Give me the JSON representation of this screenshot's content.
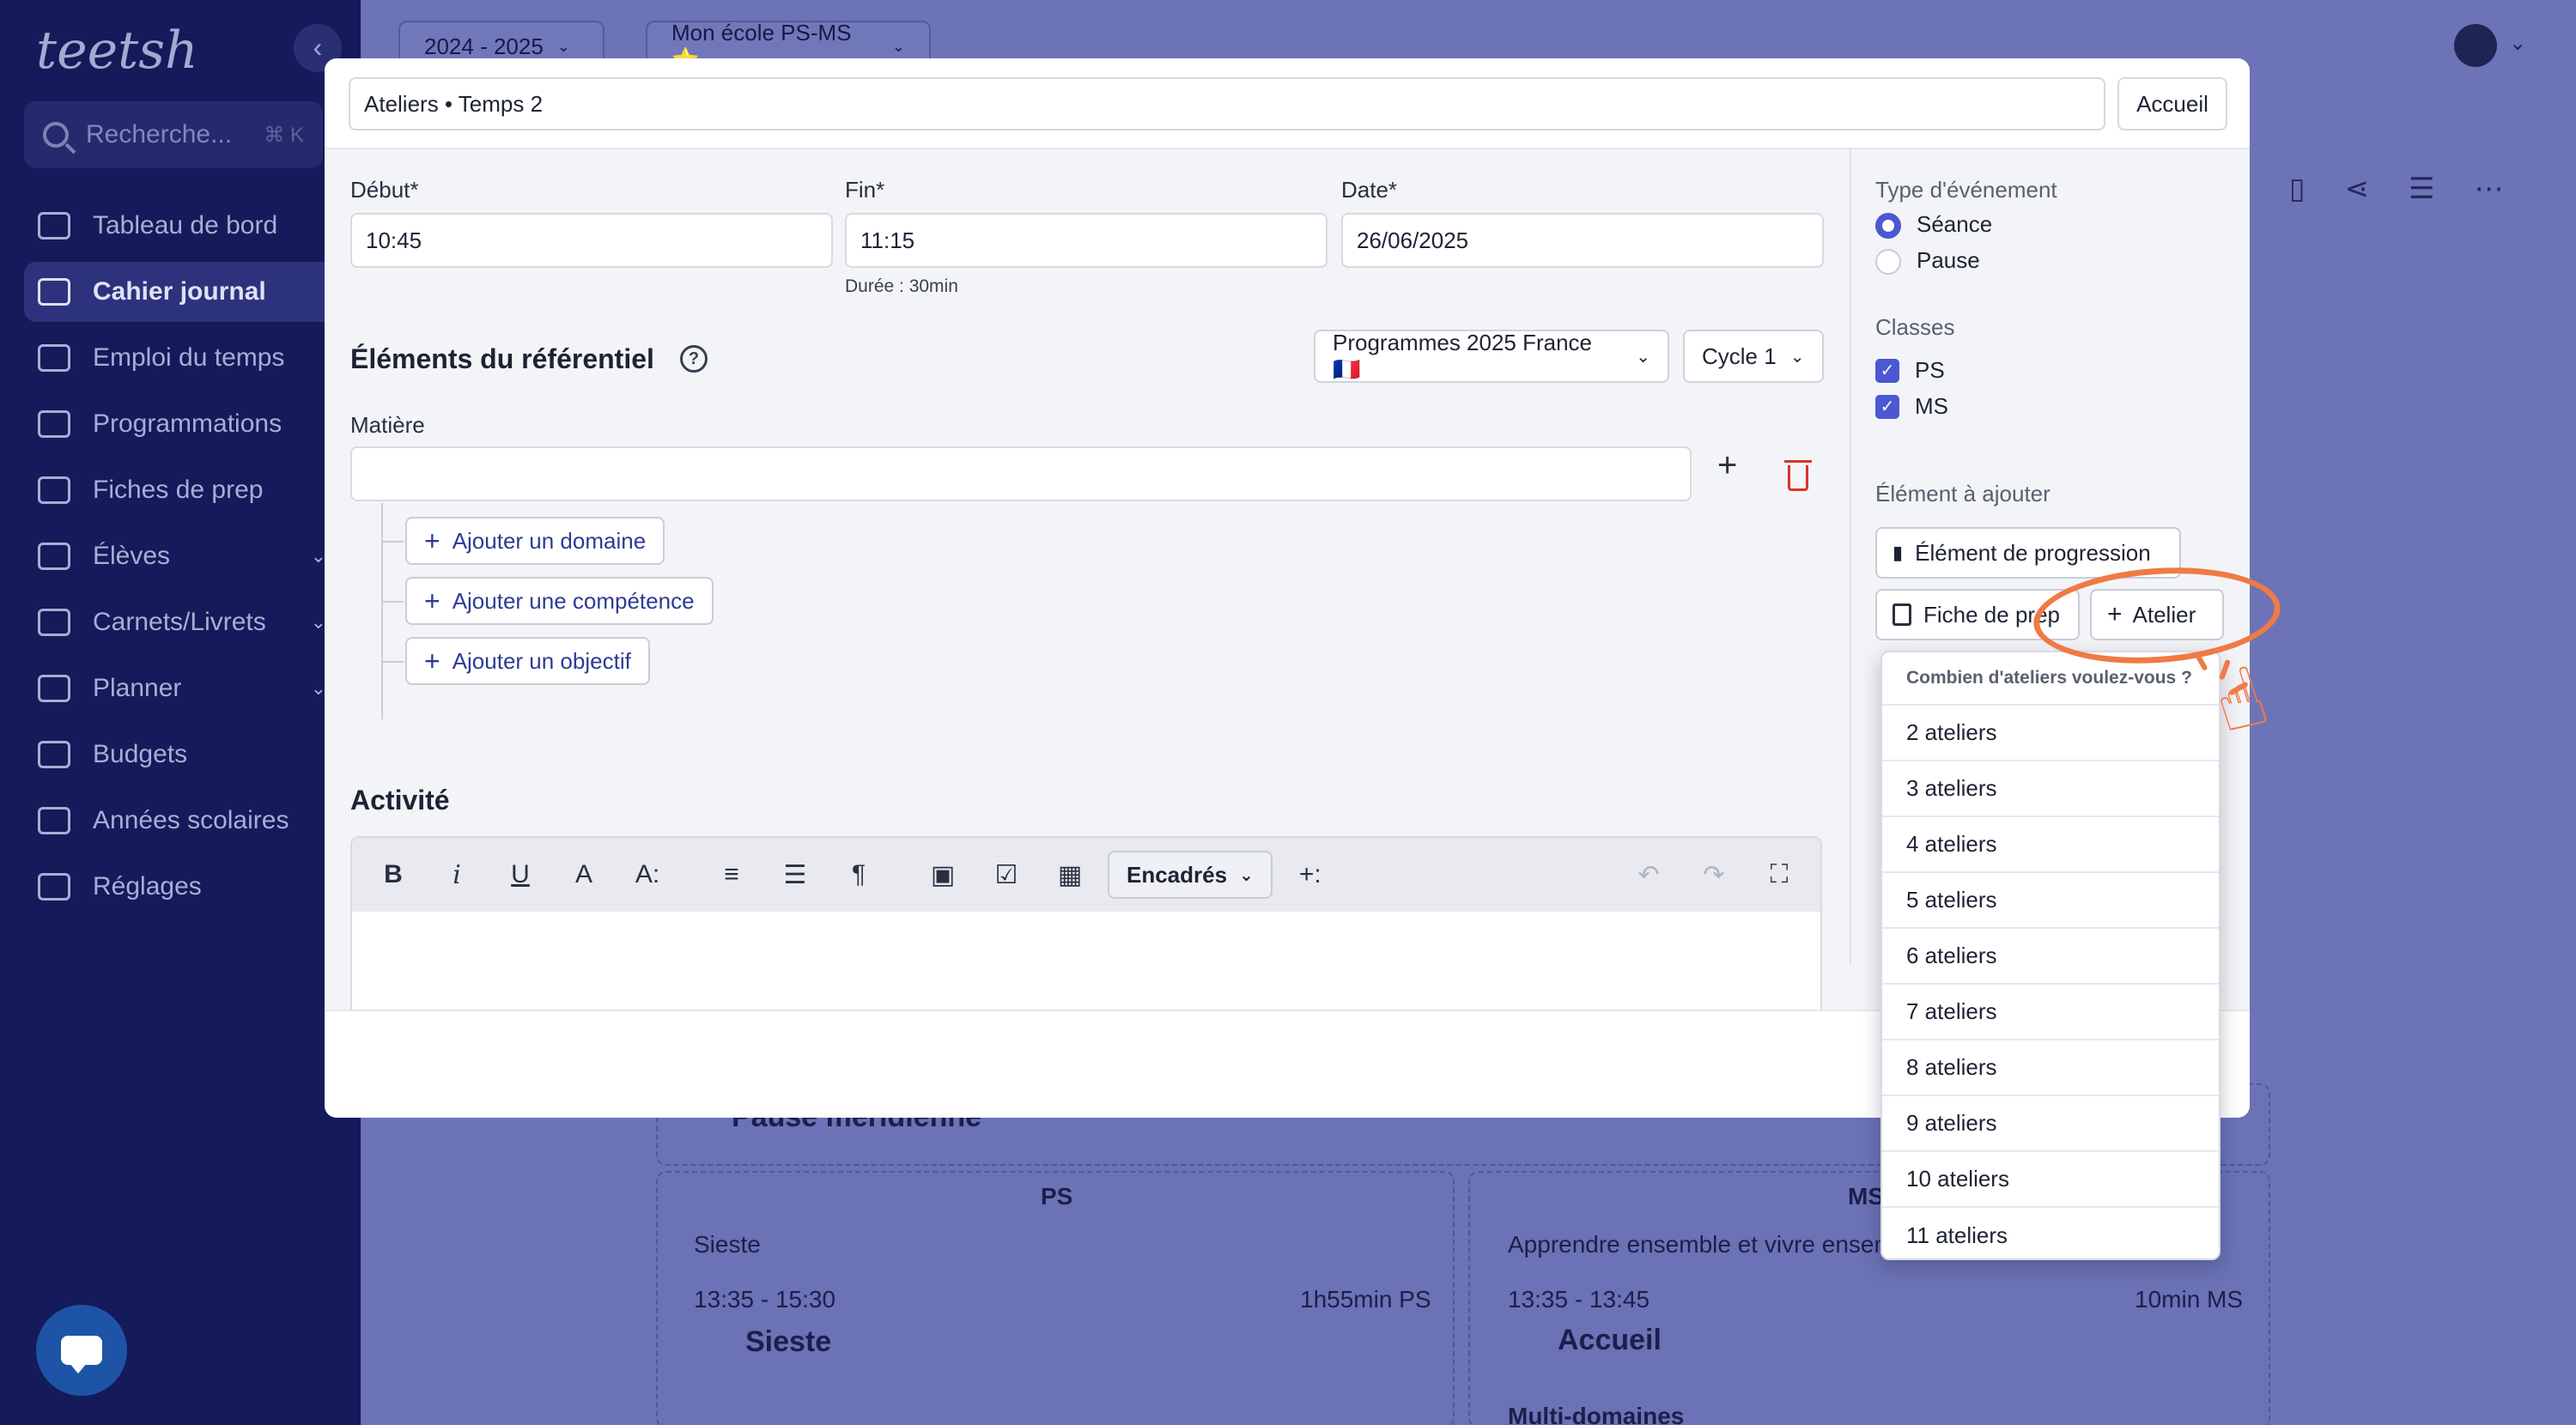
{
  "app": {
    "logo": "teetsh"
  },
  "sidebar": {
    "search_placeholder": "Recherche...",
    "search_shortcut": "⌘ K",
    "items": [
      {
        "label": "Tableau de bord",
        "icon": "dashboard-icon"
      },
      {
        "label": "Cahier journal",
        "icon": "book-icon",
        "active": true
      },
      {
        "label": "Emploi du temps",
        "icon": "calendar-icon"
      },
      {
        "label": "Programmations",
        "icon": "program-icon"
      },
      {
        "label": "Fiches de prep",
        "icon": "file-icon"
      },
      {
        "label": "Élèves",
        "icon": "students-icon",
        "expandable": true
      },
      {
        "label": "Carnets/Livrets",
        "icon": "notebook-icon",
        "expandable": true
      },
      {
        "label": "Planner",
        "icon": "planner-icon",
        "expandable": true
      },
      {
        "label": "Budgets",
        "icon": "piggy-bank-icon"
      },
      {
        "label": "Années scolaires",
        "icon": "school-icon"
      },
      {
        "label": "Réglages",
        "icon": "settings-icon"
      }
    ]
  },
  "topbar": {
    "year": "2024 - 2025",
    "school": "Mon école PS-MS ⭐"
  },
  "background": {
    "pause_label": "Pause méridienne",
    "col_ps": "PS",
    "col_ms": "MS",
    "ps_card_title": "Sieste",
    "ps_card_time": "13:35 - 15:30",
    "ps_card_duration": "1h55min PS",
    "ps_card_name": "Sieste",
    "ms_card_title": "Apprendre ensemble et vivre ensemble",
    "ms_card_time": "13:35 - 13:45",
    "ms_card_duration": "10min MS",
    "ms_card_name": "Accueil",
    "ms_card2_title": "Multi-domaines"
  },
  "modal": {
    "title_value": "Ateliers • Temps 2",
    "accueil_button": "Accueil",
    "start_label": "Début*",
    "start_value": "10:45",
    "end_label": "Fin*",
    "end_value": "11:15",
    "duration_text": "Durée : 30min",
    "date_label": "Date*",
    "date_value": "26/06/2025",
    "ref_title": "Éléments du référentiel",
    "program_select": "Programmes 2025 France 🇫🇷",
    "cycle_select": "Cycle 1",
    "subject_label": "Matière",
    "subject_value": "",
    "add_domain": "Ajouter un domaine",
    "add_competence": "Ajouter une compétence",
    "add_objective": "Ajouter un objectif",
    "activity_title": "Activité",
    "encadres_label": "Encadrés"
  },
  "right_panel": {
    "event_type_label": "Type d'événement",
    "event_types": [
      {
        "label": "Séance",
        "checked": true
      },
      {
        "label": "Pause",
        "checked": false
      }
    ],
    "classes_label": "Classes",
    "classes": [
      {
        "label": "PS",
        "checked": true
      },
      {
        "label": "MS",
        "checked": true
      }
    ],
    "element_label": "Élément à ajouter",
    "progression_button": "Élément de progression",
    "fiche_button": "Fiche de prep",
    "atelier_button": "Atelier"
  },
  "dropdown": {
    "header": "Combien d'ateliers voulez-vous ?",
    "options": [
      "2 ateliers",
      "3 ateliers",
      "4 ateliers",
      "5 ateliers",
      "6 ateliers",
      "7 ateliers",
      "8 ateliers",
      "9 ateliers",
      "10 ateliers",
      "11 ateliers"
    ]
  },
  "colors": {
    "sidebar": "#151a5a",
    "overlay": "#6c74b7",
    "accent": "#4c58d2",
    "annotation": "#f07a45",
    "link": "#2d3a96",
    "danger": "#d9342b"
  }
}
